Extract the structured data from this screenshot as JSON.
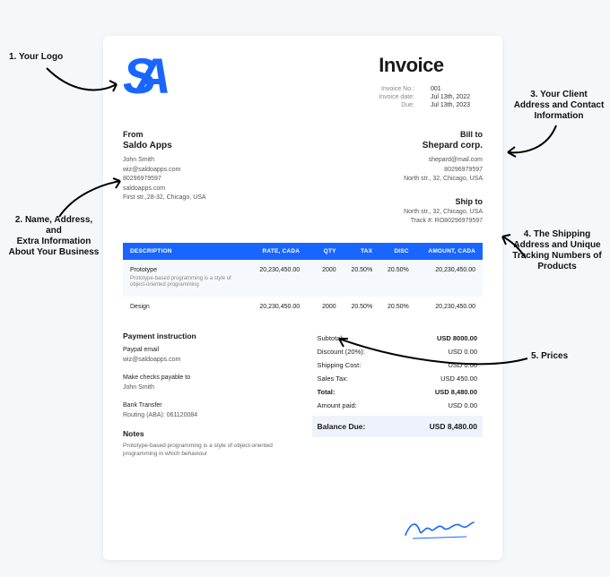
{
  "title": "Invoice",
  "meta": {
    "no_label": "Invoice No.:",
    "no": "001",
    "date_label": "Invoice date:",
    "date": "Jul 13th, 2022",
    "due_label": "Due:",
    "due": "Jul 13th, 2023"
  },
  "from": {
    "heading": "From",
    "company": "Saldo Apps",
    "lines": [
      "John Smith",
      "wiz@saldoapps.com",
      "80296979597",
      "saldoapps.com",
      "First str.,28-32, Chicago, USA"
    ]
  },
  "billto": {
    "heading": "Bill to",
    "company": "Shepard corp.",
    "lines": [
      "shepard@mail.com",
      "80296979597",
      "North str., 32, Chicago, USA"
    ]
  },
  "shipto": {
    "heading": "Ship to",
    "lines": [
      "North str., 32, Chicago, USA",
      "Track #: RO80296979597"
    ]
  },
  "table": {
    "headers": [
      "DESCRIPTION",
      "RATE, CADA",
      "QTY",
      "TAX",
      "DISC",
      "AMOUNT, CADA"
    ],
    "rows": [
      {
        "desc": "Prototype",
        "sub": "Prototype-based programming is a style of object-oriented programming",
        "rate": "20,230,450.00",
        "qty": "2000",
        "tax": "20.50%",
        "disc": "20.50%",
        "amt": "20,230,450.00"
      },
      {
        "desc": "Design",
        "sub": "",
        "rate": "20,230,450.00",
        "qty": "2000",
        "tax": "20.50%",
        "disc": "20.50%",
        "amt": "20,230,450.00"
      }
    ]
  },
  "payment": {
    "heading": "Payment instruction",
    "paypal_label": "Paypal email",
    "paypal": "wiz@saldoapps.com",
    "checks_label": "Make checks payable to",
    "checks": "John Smith",
    "bank_label": "Bank Transfer",
    "bank": "Routing (ABA): 061120084"
  },
  "totals": {
    "subtotal_label": "Subtotal:",
    "subtotal": "USD 8000.00",
    "discount_label": "Discount (20%):",
    "discount": "USD 0.00",
    "shipping_label": "Shipping Cost:",
    "shipping": "USD 0.00",
    "tax_label": "Sales Tax:",
    "tax": "USD 450.00",
    "total_label": "Total:",
    "total": "USD 8,480.00",
    "paid_label": "Amount paid:",
    "paid": "USD 0.00",
    "balance_label": "Balance Due:",
    "balance": "USD 8,480.00"
  },
  "notes": {
    "heading": "Notes",
    "text": "Prototype-based programming is a style of object-oriented programming in which behaviour"
  },
  "annotations": {
    "a1": "1. Your Logo",
    "a2": "2. Name, Address,\nand\nExtra Information\nAbout Your Business",
    "a3": "3. Your Client\nAddress and Contact\nInformation",
    "a4": "4. The Shipping\nAddress and Unique\nTracking Numbers of\nProducts",
    "a5": "5. Prices"
  }
}
